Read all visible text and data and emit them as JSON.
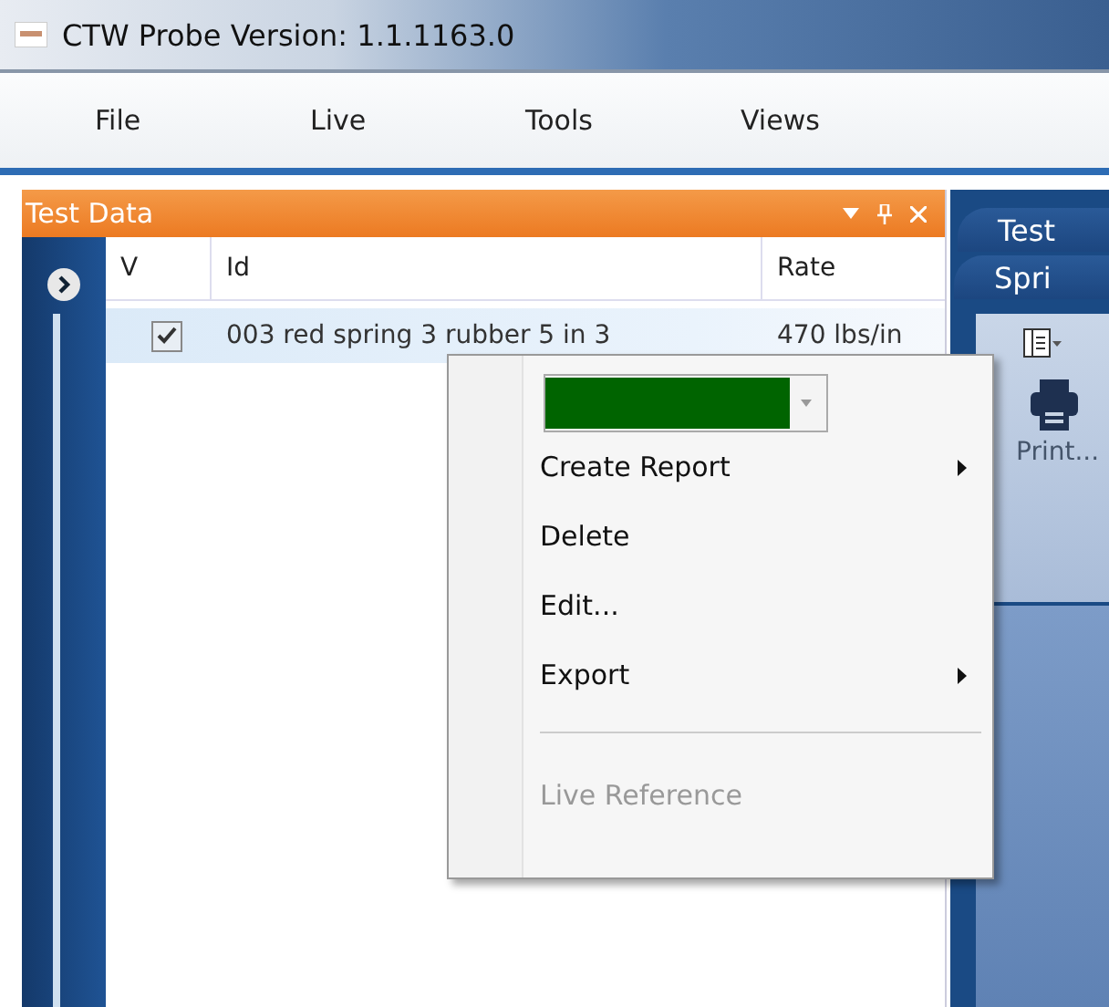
{
  "window": {
    "title": "CTW Probe Version: 1.1.1163.0"
  },
  "menu": [
    "File",
    "Live",
    "Tools",
    "Views"
  ],
  "panel": {
    "title": "Test Data",
    "columns": [
      "V",
      "Id",
      "Rate"
    ],
    "rows": [
      {
        "checked": true,
        "selected": true,
        "id": "003 red spring 3 rubber 5 in 3",
        "rate": "470 lbs/in"
      }
    ]
  },
  "side_tabs": [
    {
      "label": "Test"
    },
    {
      "label": "Spri"
    }
  ],
  "toolbar": {
    "print_label": "Print..."
  },
  "context_menu": {
    "color": "#006400",
    "items": [
      {
        "label": "Create Report",
        "submenu": true,
        "disabled": false,
        "separator_before": false
      },
      {
        "label": "Delete",
        "submenu": false,
        "disabled": false,
        "separator_before": false
      },
      {
        "label": "Edit...",
        "submenu": false,
        "disabled": false,
        "separator_before": false
      },
      {
        "label": "Export",
        "submenu": true,
        "disabled": false,
        "separator_before": false
      },
      {
        "label": "Live Reference",
        "submenu": false,
        "disabled": true,
        "separator_before": true
      }
    ]
  }
}
